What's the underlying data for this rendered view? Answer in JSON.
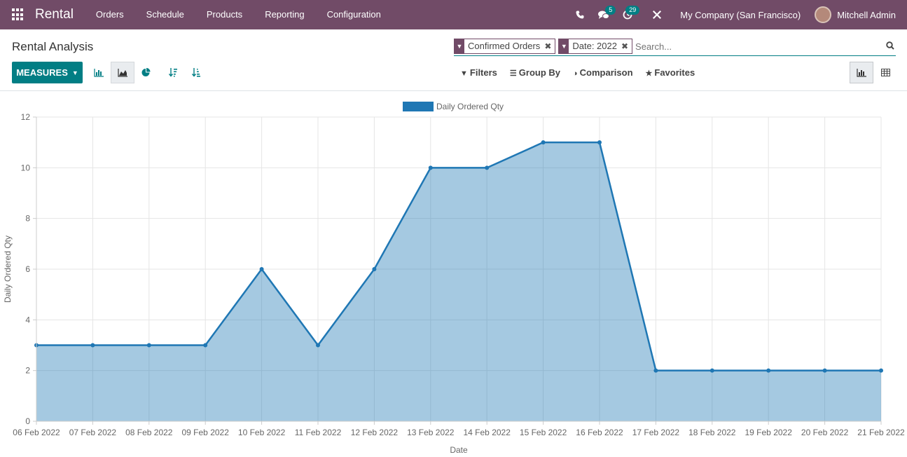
{
  "navbar": {
    "app_name": "Rental",
    "menu": [
      "Orders",
      "Schedule",
      "Products",
      "Reporting",
      "Configuration"
    ],
    "messages_count": "5",
    "activities_count": "29",
    "company": "My Company (San Francisco)",
    "user": "Mitchell Admin",
    "icons": [
      "apps-icon",
      "phone-icon",
      "chat-icon",
      "clock-icon",
      "tools-icon"
    ],
    "color": "#714b67"
  },
  "control_panel": {
    "title": "Rental Analysis",
    "facets": [
      {
        "label": "Confirmed Orders"
      },
      {
        "label": "Date: 2022"
      }
    ],
    "search_placeholder": "Search...",
    "measures_label": "MEASURES",
    "filters_label": "Filters",
    "group_by_label": "Group By",
    "comparison_label": "Comparison",
    "favorites_label": "Favorites",
    "accent_color": "#017e84"
  },
  "chart_data": {
    "type": "area",
    "categories": [
      "06 Feb 2022",
      "07 Feb 2022",
      "08 Feb 2022",
      "09 Feb 2022",
      "10 Feb 2022",
      "11 Feb 2022",
      "12 Feb 2022",
      "13 Feb 2022",
      "14 Feb 2022",
      "15 Feb 2022",
      "16 Feb 2022",
      "17 Feb 2022",
      "18 Feb 2022",
      "19 Feb 2022",
      "20 Feb 2022",
      "21 Feb 2022"
    ],
    "series": [
      {
        "name": "Daily Ordered Qty",
        "values": [
          3,
          3,
          3,
          3,
          6,
          3,
          6,
          10,
          10,
          11,
          11,
          2,
          2,
          2,
          2,
          2
        ],
        "color": "#1f77b4"
      }
    ],
    "xlabel": "Date",
    "ylabel": "Daily Ordered Qty",
    "ylim": [
      0,
      12
    ],
    "yticks": [
      0,
      2,
      4,
      6,
      8,
      10,
      12
    ],
    "grid": true,
    "legend": "top-center"
  }
}
